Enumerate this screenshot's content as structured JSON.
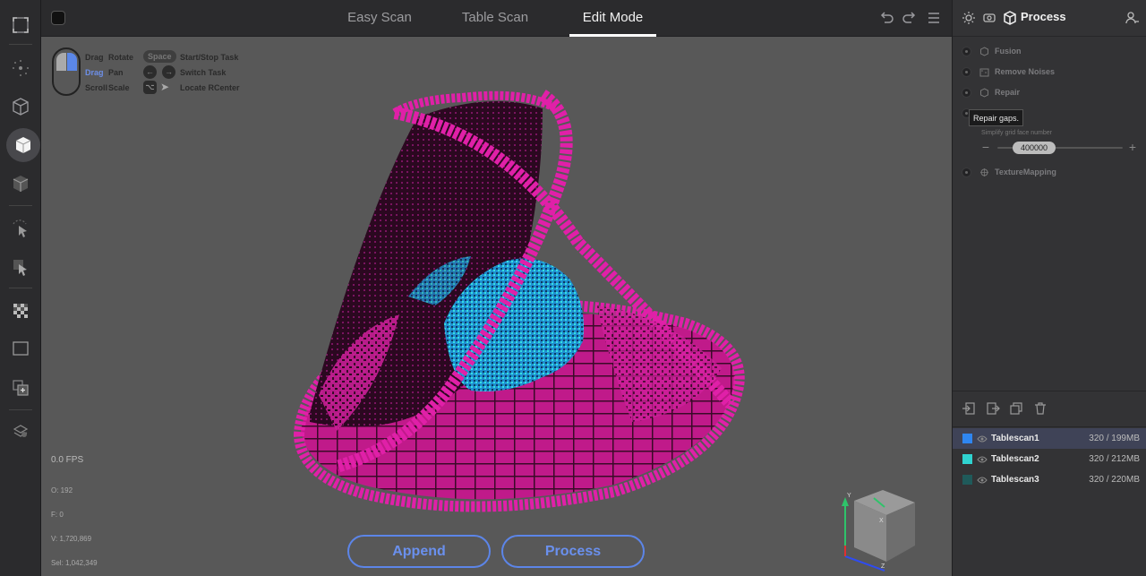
{
  "tabs": [
    {
      "label": "Easy Scan",
      "active": false
    },
    {
      "label": "Table Scan",
      "active": false
    },
    {
      "label": "Edit Mode",
      "active": true
    }
  ],
  "left_tools": [
    "select-box-icon",
    "point-select-icon",
    "wireframe-cube-icon",
    "solid-cube-icon",
    "shaded-cube-icon",
    "pointer-icon",
    "select-arrow-icon",
    "checker-icon",
    "frame-icon",
    "add-frame-icon",
    "layers-icon"
  ],
  "help": {
    "rows": [
      {
        "k1": "Drag",
        "k2": "Rotate",
        "key": "Space",
        "action": "Start/Stop Task"
      },
      {
        "k1": "Drag",
        "k2": "Pan",
        "key": "",
        "action": "Switch Task"
      },
      {
        "k1": "Scroll",
        "k2": "Scale",
        "key": "",
        "action": "Locate RCenter"
      }
    ]
  },
  "stats": {
    "fps": "0.0 FPS",
    "o": "O: 192",
    "f": "F: 0",
    "v": "V: 1,720,869",
    "sel": "Sel: 1,042,349"
  },
  "buttons": {
    "append": "Append",
    "process": "Process"
  },
  "panel": {
    "title": "Process",
    "steps": [
      {
        "label": "Fusion",
        "icon": "fusion-icon"
      },
      {
        "label": "Remove Noises",
        "icon": "remove-noises-icon"
      },
      {
        "label": "Repair",
        "icon": "repair-icon"
      },
      {
        "label": "",
        "icon": ""
      },
      {
        "label": "TextureMapping",
        "icon": "texture-icon"
      }
    ],
    "tooltip": "Repair gaps.",
    "simplify_label": "Simplify grid face number",
    "simplify_value": "400000",
    "scans": [
      {
        "name": "Tablescan1",
        "size": "320 / 199MB",
        "color": "#2f86f0",
        "selected": true
      },
      {
        "name": "Tablescan2",
        "size": "320 / 212MB",
        "color": "#2fd3d0",
        "selected": false
      },
      {
        "name": "Tablescan3",
        "size": "320 / 220MB",
        "color": "#1f5a5a",
        "selected": false
      }
    ]
  },
  "colors": {
    "accent": "#5c85e8",
    "magenta": "#e020a8",
    "cyan": "#30b8e0"
  }
}
